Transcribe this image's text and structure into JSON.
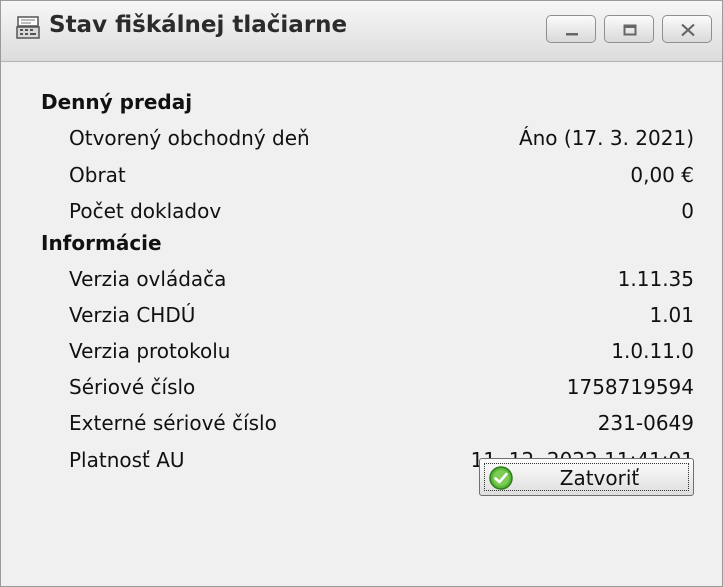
{
  "window": {
    "title": "Stav fiškálnej tlačiarne",
    "controls": {
      "minimize": "minimize-icon",
      "maximize": "maximize-icon",
      "close": "close-icon"
    }
  },
  "sections": [
    {
      "title": "Denný predaj",
      "rows": [
        {
          "label": "Otvorený obchodný deň",
          "value": "Áno (17. 3. 2021)"
        },
        {
          "label": "Obrat",
          "value": "0,00 €"
        },
        {
          "label": "Počet dokladov",
          "value": "0"
        }
      ]
    },
    {
      "title": "Informácie",
      "rows": [
        {
          "label": "Verzia ovládača",
          "value": "1.11.35"
        },
        {
          "label": "Verzia CHDÚ",
          "value": "1.01"
        },
        {
          "label": "Verzia protokolu",
          "value": "1.0.11.0"
        },
        {
          "label": "Sériové číslo",
          "value": "1758719594"
        },
        {
          "label": "Externé sériové číslo",
          "value": "231-0649"
        },
        {
          "label": "Platnosť AU",
          "value": "11. 12. 2022 11:41:01"
        }
      ]
    }
  ],
  "buttons": {
    "close_label": "Zatvoriť",
    "close_icon": "check-circle-icon"
  },
  "colors": {
    "titlebar": "#e6e6e6",
    "body": "#f0f0f0",
    "ok_icon": "#4aa52e"
  }
}
